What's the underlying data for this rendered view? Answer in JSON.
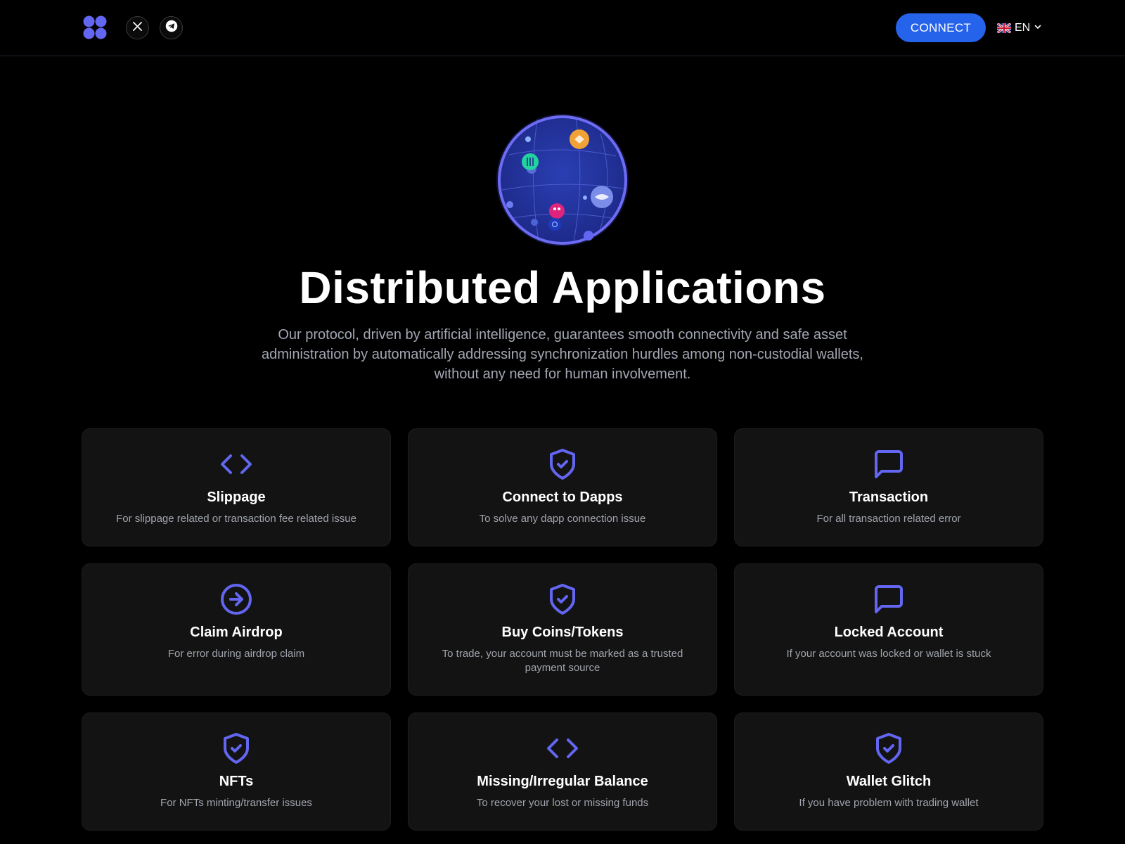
{
  "header": {
    "logo_icon": "four-dots-logo-icon",
    "social": [
      {
        "name": "x",
        "icon": "x-icon"
      },
      {
        "name": "telegram",
        "icon": "telegram-icon"
      }
    ],
    "connect_label": "CONNECT",
    "language": {
      "code": "EN",
      "flag_icon": "uk-flag-icon",
      "chevron_icon": "chevron-down-icon"
    }
  },
  "hero": {
    "globe_icon": "dapps-globe-icon",
    "title": "Distributed Applications",
    "subtitle": "Our protocol, driven by artificial intelligence, guarantees smooth connectivity and safe asset administration by automatically addressing synchronization hurdles among non-custodial wallets, without any need for human involvement."
  },
  "colors": {
    "background": "#000000",
    "card": "#131313",
    "accent": "#6366f1",
    "button": "#2563eb",
    "muted_text": "#a3a7b3"
  },
  "cards": [
    {
      "title": "Slippage",
      "description": "For slippage related or transaction fee related issue",
      "icon": "code-icon"
    },
    {
      "title": "Connect to Dapps",
      "description": "To solve any dapp connection issue",
      "icon": "shield-check-icon"
    },
    {
      "title": "Transaction",
      "description": "For all transaction related error",
      "icon": "message-square-icon"
    },
    {
      "title": "Claim Airdrop",
      "description": "For error during airdrop claim",
      "icon": "arrow-right-circle-icon"
    },
    {
      "title": "Buy Coins/Tokens",
      "description": "To trade, your account must be marked as a trusted payment source",
      "icon": "shield-check-icon"
    },
    {
      "title": "Locked Account",
      "description": "If your account was locked or wallet is stuck",
      "icon": "message-square-icon"
    },
    {
      "title": "NFTs",
      "description": "For NFTs minting/transfer issues",
      "icon": "shield-check-icon"
    },
    {
      "title": "Missing/Irregular Balance",
      "description": "To recover your lost or missing funds",
      "icon": "code-icon"
    },
    {
      "title": "Wallet Glitch",
      "description": "If you have problem with trading wallet",
      "icon": "shield-check-icon"
    }
  ]
}
